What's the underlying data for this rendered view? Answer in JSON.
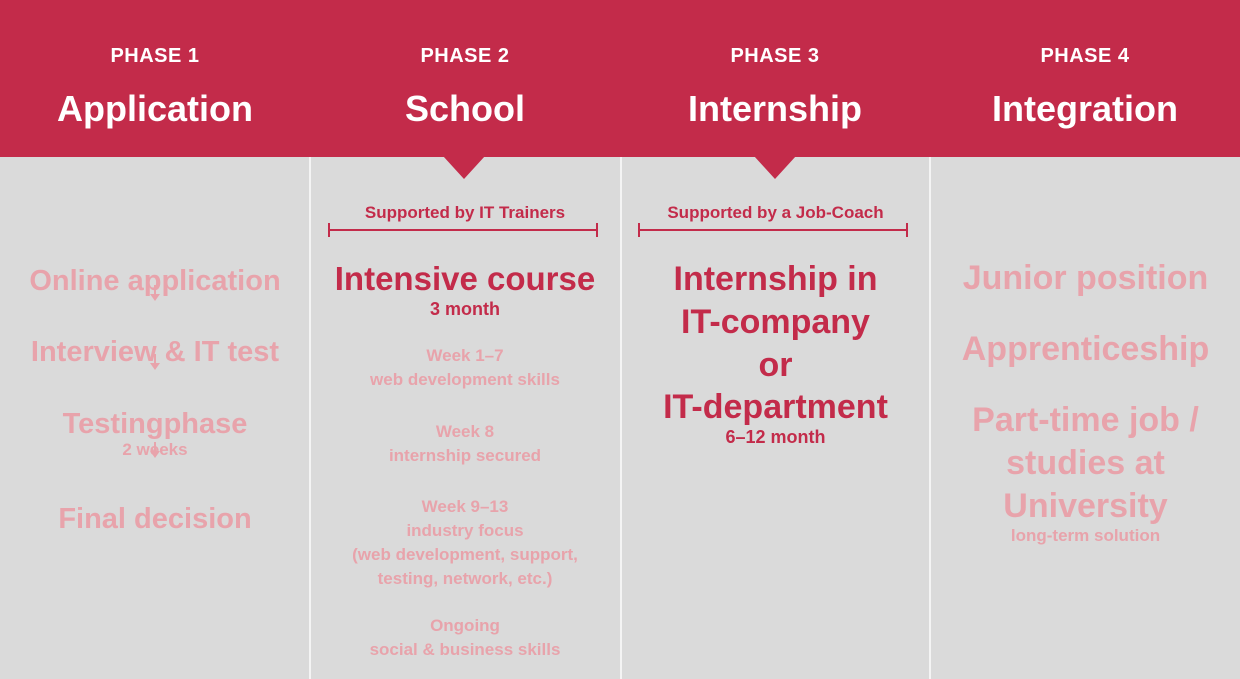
{
  "phases": [
    {
      "number": "PHASE 1",
      "title": "Application"
    },
    {
      "number": "PHASE 2",
      "title": "School"
    },
    {
      "number": "PHASE 3",
      "title": "Internship"
    },
    {
      "number": "PHASE 4",
      "title": "Integration"
    }
  ],
  "application": {
    "steps": [
      {
        "label": "Online application"
      },
      {
        "label": "Interview & IT test"
      },
      {
        "label": "Testingphase",
        "sub": "2 weeks"
      },
      {
        "label": "Final decision"
      }
    ]
  },
  "school": {
    "support": "Supported by IT Trainers",
    "main_title": "Intensive course",
    "main_duration": "3 month",
    "items": [
      {
        "lines": [
          "Week 1–7",
          "web development skills"
        ]
      },
      {
        "lines": [
          "Week 8",
          "internship secured"
        ]
      },
      {
        "lines": [
          "Week 9–13",
          "industry focus",
          "(web development, support,",
          "testing, network, etc.)"
        ]
      },
      {
        "lines": [
          "Ongoing",
          "social & business skills"
        ]
      }
    ]
  },
  "internship": {
    "support": "Supported by a Job-Coach",
    "lines": [
      "Internship in",
      "IT-company",
      "or",
      "IT-department"
    ],
    "duration": "6–12 month"
  },
  "integration": {
    "items": [
      "Junior position",
      "Apprenticeship"
    ],
    "last_lines": [
      "Part-time job /",
      "studies at",
      "University"
    ],
    "last_sub": "long-term solution"
  },
  "colors": {
    "accent": "#c32b4a",
    "faded": "#e8a3ab",
    "background": "#dadada"
  }
}
